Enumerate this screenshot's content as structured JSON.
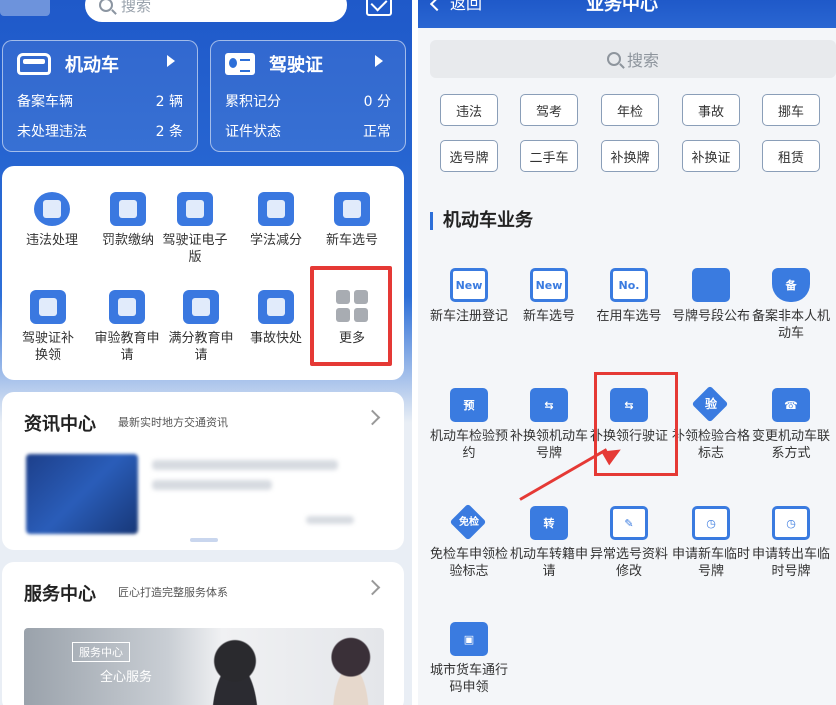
{
  "left": {
    "search_placeholder": "搜索",
    "vehicle_card": {
      "title": "机动车",
      "rows": [
        {
          "label": "备案车辆",
          "value": "2 辆"
        },
        {
          "label": "未处理违法",
          "value": "2 条"
        }
      ]
    },
    "license_card": {
      "title": "驾驶证",
      "rows": [
        {
          "label": "累积记分",
          "value": "0 分"
        },
        {
          "label": "证件状态",
          "value": "正常"
        }
      ]
    },
    "services": [
      {
        "label": "违法处理",
        "icon": "violation-icon"
      },
      {
        "label": "罚款缴纳",
        "icon": "fine-icon"
      },
      {
        "label": "驾驶证电子版",
        "icon": "e-license-icon"
      },
      {
        "label": "学法减分",
        "icon": "book-icon"
      },
      {
        "label": "新车选号",
        "icon": "new-plate-icon"
      },
      {
        "label": "驾驶证补换领",
        "icon": "license-replace-icon"
      },
      {
        "label": "审验教育申请",
        "icon": "document-icon"
      },
      {
        "label": "满分教育申请",
        "icon": "calendar-icon"
      },
      {
        "label": "事故快处",
        "icon": "accident-icon"
      },
      {
        "label": "更多",
        "icon": "more-grid-icon"
      }
    ],
    "news": {
      "title": "资讯中心",
      "subtitle": "最新实时地方交通资讯"
    },
    "service_center": {
      "title": "服务中心",
      "subtitle": "匠心打造完整服务体系",
      "banner_tag": "服务中心",
      "banner_text": "全心服务"
    }
  },
  "right": {
    "back_label": "返回",
    "title": "业务中心",
    "search_placeholder": "搜索",
    "tags": [
      "违法",
      "驾考",
      "年检",
      "事故",
      "挪车",
      "选号牌",
      "二手车",
      "补换牌",
      "补换证",
      "租赁"
    ],
    "section_title": "机动车业务",
    "items": [
      {
        "label": "新车注册登记",
        "icon": "new-registration-icon",
        "glyph": "New"
      },
      {
        "label": "新车选号",
        "icon": "new-plate-select-icon",
        "glyph": "New"
      },
      {
        "label": "在用车选号",
        "icon": "plate-number-icon",
        "glyph": "No."
      },
      {
        "label": "号牌号段公布",
        "icon": "plate-tag-icon",
        "glyph": ""
      },
      {
        "label": "备案非本人机动车",
        "icon": "shield-icon",
        "glyph": "备"
      },
      {
        "label": "机动车检验预约",
        "icon": "inspection-truck-icon",
        "glyph": "预"
      },
      {
        "label": "补换领机动车号牌",
        "icon": "swap-plate-icon",
        "glyph": "⇆"
      },
      {
        "label": "补换领行驶证",
        "icon": "swap-car-icon",
        "glyph": "⇆"
      },
      {
        "label": "补领检验合格标志",
        "icon": "inspection-diamond-icon",
        "glyph": "验"
      },
      {
        "label": "变更机动车联系方式",
        "icon": "car-phone-icon",
        "glyph": "☎"
      },
      {
        "label": "免检车申领检验标志",
        "icon": "exempt-diamond-icon",
        "glyph": "免检"
      },
      {
        "label": "机动车转籍申请",
        "icon": "transfer-truck-icon",
        "glyph": "转"
      },
      {
        "label": "异常选号资料修改",
        "icon": "edit-icon",
        "glyph": "✎"
      },
      {
        "label": "申请新车临时号牌",
        "icon": "temp-plate-icon",
        "glyph": "◷"
      },
      {
        "label": "申请转出车临时号牌",
        "icon": "temp-plate-out-icon",
        "glyph": "◷"
      },
      {
        "label": "城市货车通行码申领",
        "icon": "truck-pass-icon",
        "glyph": "▣"
      }
    ]
  },
  "colors": {
    "primary": "#2d6fd8",
    "highlight": "#e53935"
  }
}
